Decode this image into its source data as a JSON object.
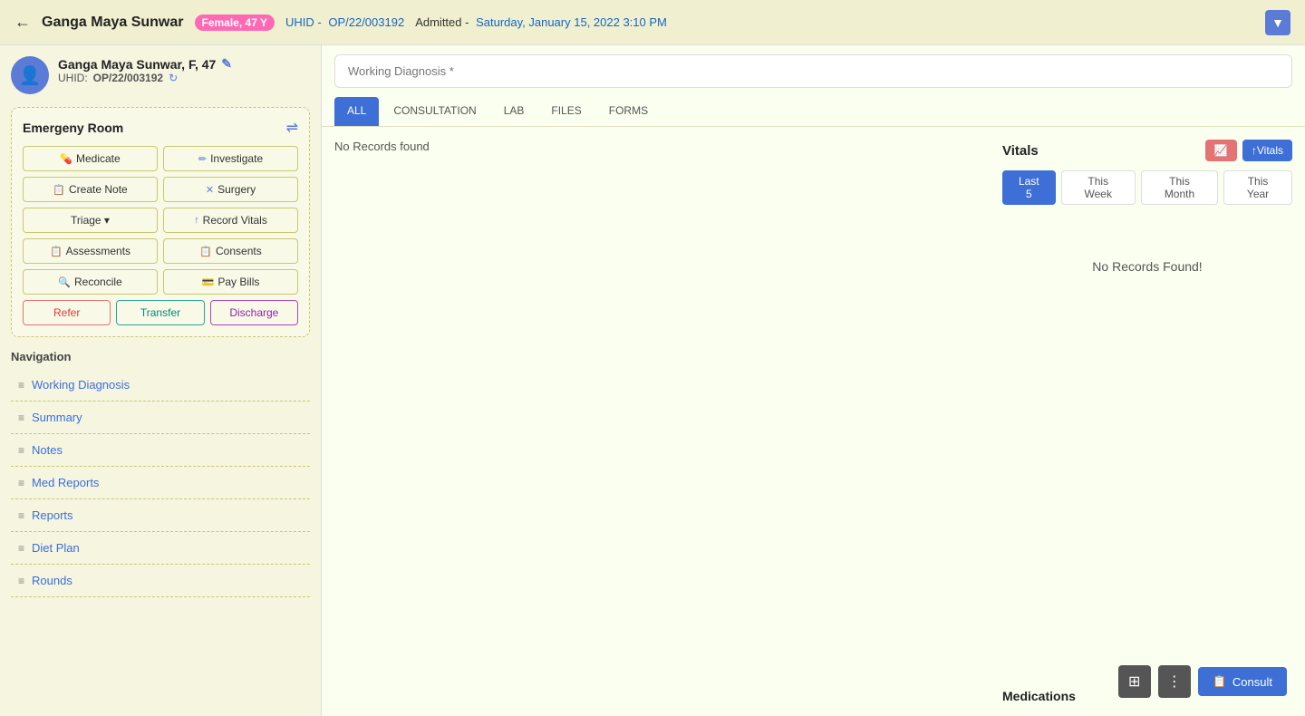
{
  "header": {
    "back_label": "←",
    "patient_name": "Ganga Maya Sunwar",
    "gender_age_badge": "Female, 47 Y",
    "uhid_label": "UHID -",
    "uhid_value": "OP/22/003192",
    "admitted_label": "Admitted -",
    "admitted_date": "Saturday, January 15, 2022 3:10 PM",
    "top_right_icon": "▼"
  },
  "patient_card": {
    "avatar_icon": "👤",
    "full_name": "Ganga Maya Sunwar, F, 47",
    "edit_icon": "✎",
    "uhid_label": "UHID:",
    "uhid_value": "OP/22/003192",
    "refresh_icon": "↻"
  },
  "emergency_room": {
    "title": "Emergeny Room",
    "filter_icon": "⇌",
    "buttons": [
      {
        "label": "Medicate",
        "icon": "💊"
      },
      {
        "label": "Investigate",
        "icon": "✏"
      },
      {
        "label": "Create Note",
        "icon": "📋"
      },
      {
        "label": "Surgery",
        "icon": "✕"
      },
      {
        "label": "Triage ▾",
        "icon": ""
      },
      {
        "label": "Record Vitals",
        "icon": "↑"
      },
      {
        "label": "Assessments",
        "icon": "📋"
      },
      {
        "label": "Consents",
        "icon": "📋"
      },
      {
        "label": "Reconcile",
        "icon": "🔍"
      },
      {
        "label": "Pay Bills",
        "icon": "💳"
      }
    ],
    "refer_label": "Refer",
    "transfer_label": "Transfer",
    "discharge_label": "Discharge"
  },
  "navigation": {
    "title": "Navigation",
    "items": [
      {
        "label": "Working Diagnosis"
      },
      {
        "label": "Summary"
      },
      {
        "label": "Notes"
      },
      {
        "label": "Med Reports"
      },
      {
        "label": "Reports"
      },
      {
        "label": "Diet Plan"
      },
      {
        "label": "Rounds"
      }
    ]
  },
  "working_diagnosis": {
    "placeholder": "Working Diagnosis *"
  },
  "tabs": [
    {
      "label": "ALL",
      "active": true
    },
    {
      "label": "CONSULTATION"
    },
    {
      "label": "LAB"
    },
    {
      "label": "FILES"
    },
    {
      "label": "FORMS"
    }
  ],
  "left_panel": {
    "no_records_text": "No Records found"
  },
  "vitals": {
    "title": "Vitals",
    "btn_red_icon": "📈",
    "btn_blue_label": "↑Vitals",
    "period_tabs": [
      {
        "label": "Last 5",
        "active": true
      },
      {
        "label": "This Week"
      },
      {
        "label": "This Month"
      },
      {
        "label": "This Year"
      }
    ],
    "no_records_text": "No Records Found!"
  },
  "medications": {
    "title": "Medications"
  },
  "bottom_actions": {
    "grid_icon": "⊞",
    "more_icon": "⋮",
    "consult_icon": "📋",
    "consult_label": "Consult"
  }
}
